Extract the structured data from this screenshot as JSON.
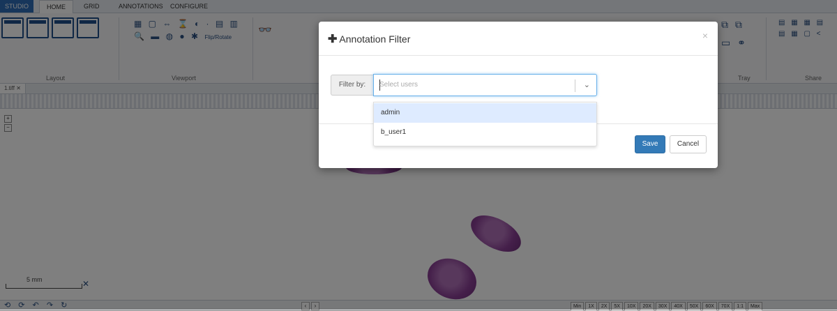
{
  "app": {
    "tabs": [
      "STUDIO",
      "HOME",
      "GRID",
      "ANNOTATIONS",
      "CONFIGURE"
    ],
    "groups": {
      "layout": "Layout",
      "viewport": "Viewport",
      "tray": "Tray",
      "share": "Share"
    },
    "flip_rotate": "Flip/Rotate",
    "doc_tab": "1.tiff",
    "scale_label": "5 mm",
    "zoom_levels": [
      "Min",
      "1X",
      "2X",
      "5X",
      "10X",
      "20X",
      "30X",
      "40X",
      "50X",
      "60X",
      "70X",
      "1:1",
      "Max"
    ]
  },
  "modal": {
    "title": "Annotation Filter",
    "close": "×",
    "filter_label": "Filter by:",
    "select_placeholder": "Select users",
    "options": [
      "admin",
      "b_user1"
    ],
    "save": "Save",
    "cancel": "Cancel"
  },
  "colors": {
    "primary": "#337ab7",
    "highlight": "#deebff",
    "focus": "#66afe9"
  }
}
